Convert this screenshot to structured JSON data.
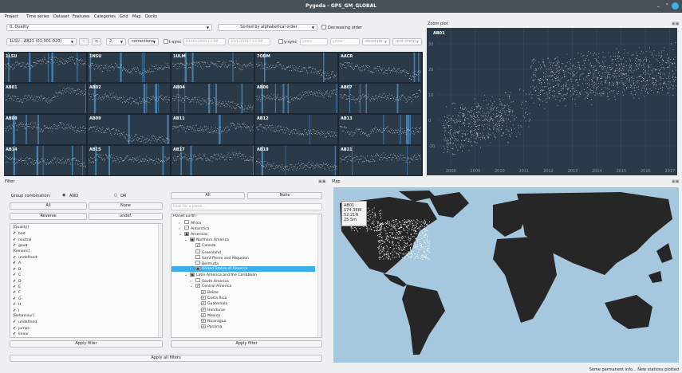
{
  "window": {
    "title": "Pygoda - GPS_GM_GLOBAL",
    "minimize": "–",
    "maximize": "˅"
  },
  "menu": [
    "Project",
    "Time series",
    "Dataset",
    "Features",
    "Categories",
    "Grid",
    "Map",
    "Docks"
  ],
  "toolbar": {
    "feature_combo": "0: Quality",
    "sort_combo": "Sorted by alphabetical order",
    "decreasing_label": "Decreasing order",
    "page_combo": "1LSU - AB21 (01:001-020)",
    "prev": "<",
    "next": ">",
    "cols_combo": "2",
    "corrections_combo": "corrections",
    "tsync_label": "t-sync",
    "date_from": "01/01/2000 12:00",
    "date_to": "31/12/2017 12:00",
    "ysync_label": "y-sync",
    "ymin_placeholder": "ymin",
    "ymax_placeholder": "ymax",
    "absolute": "absolute",
    "unit": "unit (mm)"
  },
  "stations": [
    "1LSU",
    "1NSU",
    "1ULM",
    "7ODM",
    "AACR",
    "AB01",
    "AB02",
    "AB04",
    "AB06",
    "AB07",
    "AB08",
    "AB09",
    "AB11",
    "AB12",
    "AB13",
    "AB14",
    "AB15",
    "AB17",
    "AB18",
    "AB21"
  ],
  "zoom": {
    "title": "Zoom plot",
    "station": "AB01",
    "y_ticks": [
      "30",
      "20",
      "10",
      "0",
      "-10"
    ],
    "x_ticks": [
      "2008",
      "2009",
      "2010",
      "2011",
      "2012",
      "2013",
      "2014",
      "2015",
      "2016",
      "2017"
    ]
  },
  "filter": {
    "title": "Filter",
    "group_label": "Group combination:",
    "and_label": "AND",
    "or_label": "OR",
    "all": "All",
    "none": "None",
    "reverse": "Reverse",
    "undef": "undef.",
    "items": [
      {
        "t": "[Quality]",
        "c": false,
        "h": true
      },
      {
        "t": "bad",
        "c": true
      },
      {
        "t": "neutral",
        "c": true
      },
      {
        "t": "good",
        "c": true
      },
      {
        "t": "[Generic]",
        "c": false,
        "h": true
      },
      {
        "t": "undefined",
        "c": true
      },
      {
        "t": "A",
        "c": true
      },
      {
        "t": "B",
        "c": true
      },
      {
        "t": "C",
        "c": true
      },
      {
        "t": "D",
        "c": true
      },
      {
        "t": "E",
        "c": true
      },
      {
        "t": "F",
        "c": true
      },
      {
        "t": "G",
        "c": true
      },
      {
        "t": "H",
        "c": true
      },
      {
        "t": "I",
        "c": true
      },
      {
        "t": "[Behaviour]",
        "c": false,
        "h": true
      },
      {
        "t": "undefined",
        "c": true
      },
      {
        "t": "jumps",
        "c": true
      },
      {
        "t": "linear",
        "c": true
      }
    ],
    "apply": "Apply filter",
    "apply_all": "Apply all filters"
  },
  "places": {
    "all": "All",
    "none": "None",
    "search_placeholder": "Look for a place...",
    "root": "Planet Earth",
    "rows": [
      {
        "t": "Africa",
        "d": 1,
        "e": "›",
        "c": ""
      },
      {
        "t": "Antarctica",
        "d": 1,
        "e": "›",
        "c": ""
      },
      {
        "t": "Americas",
        "d": 1,
        "e": "⌄",
        "c": "■"
      },
      {
        "t": "Northern America",
        "d": 2,
        "e": "⌄",
        "c": "■"
      },
      {
        "t": "Canada",
        "d": 3,
        "e": "",
        "c": "✔"
      },
      {
        "t": "Greenland",
        "d": 3,
        "e": "",
        "c": ""
      },
      {
        "t": "Saint Pierre and Miquelon",
        "d": 3,
        "e": "",
        "c": ""
      },
      {
        "t": "Bermuda",
        "d": 3,
        "e": "",
        "c": ""
      },
      {
        "t": "United States of America",
        "d": 3,
        "e": "›",
        "c": "■",
        "s": true
      },
      {
        "t": "Latin America and the Caribbean",
        "d": 2,
        "e": "⌄",
        "c": "■"
      },
      {
        "t": "South America",
        "d": 3,
        "e": "›",
        "c": ""
      },
      {
        "t": "Central America",
        "d": 3,
        "e": "⌄",
        "c": "✔"
      },
      {
        "t": "Belize",
        "d": 4,
        "e": "",
        "c": "✔"
      },
      {
        "t": "Costa Rica",
        "d": 4,
        "e": "",
        "c": "✔"
      },
      {
        "t": "Guatemala",
        "d": 4,
        "e": "",
        "c": "✔"
      },
      {
        "t": "Honduras",
        "d": 4,
        "e": "",
        "c": "✔"
      },
      {
        "t": "Mexico",
        "d": 4,
        "e": "",
        "c": "✔"
      },
      {
        "t": "Nicaragua",
        "d": 4,
        "e": "",
        "c": "✔"
      },
      {
        "t": "Panama",
        "d": 4,
        "e": "",
        "c": "✔"
      }
    ],
    "apply": "Apply filter"
  },
  "map": {
    "title": "Map",
    "tooltip": [
      "AB01",
      "174.38W",
      "52.21N",
      "25.5m"
    ]
  },
  "status": "Some permanent info...  New stations plotted",
  "colors": {
    "accent": "#3daee9",
    "plot_bg": "#2b3a48",
    "map_ocean": "#a5c8df",
    "land": "#262626"
  }
}
